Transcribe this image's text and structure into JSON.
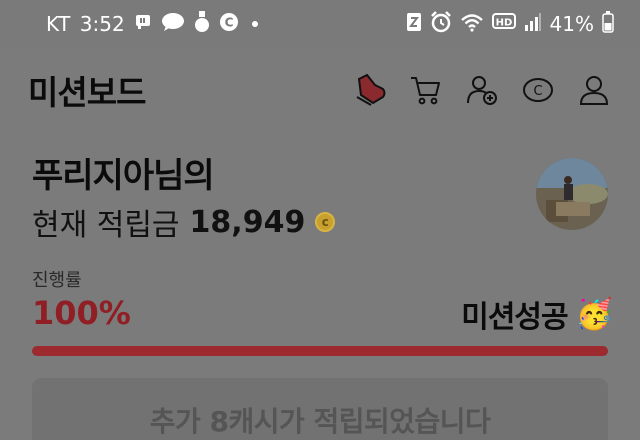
{
  "status_bar": {
    "carrier": "KT",
    "time": "3:52",
    "battery": "41%",
    "icons_left": [
      "flag-icon",
      "chat-bubble-icon",
      "medal-icon",
      "c-coin-icon"
    ],
    "icons_right": [
      "nfc-icon",
      "alarm-icon",
      "wifi-icon",
      "hd-voice-icon",
      "signal-icon",
      "battery-icon"
    ]
  },
  "header": {
    "title": "미션보드",
    "icons": [
      "shoe-icon",
      "cart-icon",
      "add-user-icon",
      "coin-icon",
      "profile-icon"
    ]
  },
  "user": {
    "greeting": "푸리지아님의",
    "points_label": "현재 적립금",
    "points_value": "18,949",
    "coin_symbol": "c"
  },
  "progress": {
    "label": "진행률",
    "value": "100%",
    "fraction": 1.0,
    "status": "미션성공",
    "status_emoji": "🥳"
  },
  "banner": {
    "text": "추가 8캐시가 적립되었습니다"
  },
  "colors": {
    "accent": "#9c2a2f",
    "progress_text": "#8f1f24",
    "coin": "#c8a02d"
  }
}
